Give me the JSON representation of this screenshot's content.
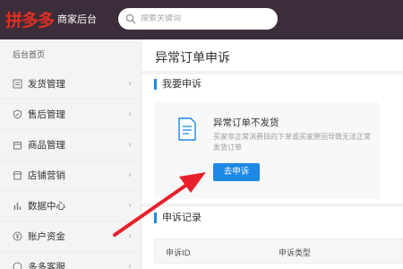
{
  "header": {
    "logo_brand": "拼多多",
    "logo_sub": "商家后台",
    "search_placeholder": "搜索关键词"
  },
  "sidebar": {
    "home": "后台首页",
    "items": [
      {
        "label": "发货管理",
        "icon": "shipping-icon"
      },
      {
        "label": "售后管理",
        "icon": "shield-icon"
      },
      {
        "label": "商品管理",
        "icon": "goods-icon"
      },
      {
        "label": "店铺营销",
        "icon": "store-icon"
      },
      {
        "label": "数据中心",
        "icon": "chart-icon"
      },
      {
        "label": "账户资金",
        "icon": "yen-icon"
      },
      {
        "label": "多多客服",
        "icon": "service-icon"
      }
    ]
  },
  "main": {
    "page_title": "异常订单申诉",
    "my_appeal": "我要申诉",
    "card": {
      "title": "异常订单不发货",
      "description": "买家非正常消费目的下单或买家原因导致无法正常发货订单",
      "button": "去申诉"
    },
    "records_title": "申诉记录",
    "table_columns": [
      "申诉ID",
      "申诉类型"
    ]
  },
  "colors": {
    "topbar": "#3b2d3a",
    "brand": "#e02e24",
    "accent": "#1e88e5",
    "arrow": "#e8202a"
  }
}
